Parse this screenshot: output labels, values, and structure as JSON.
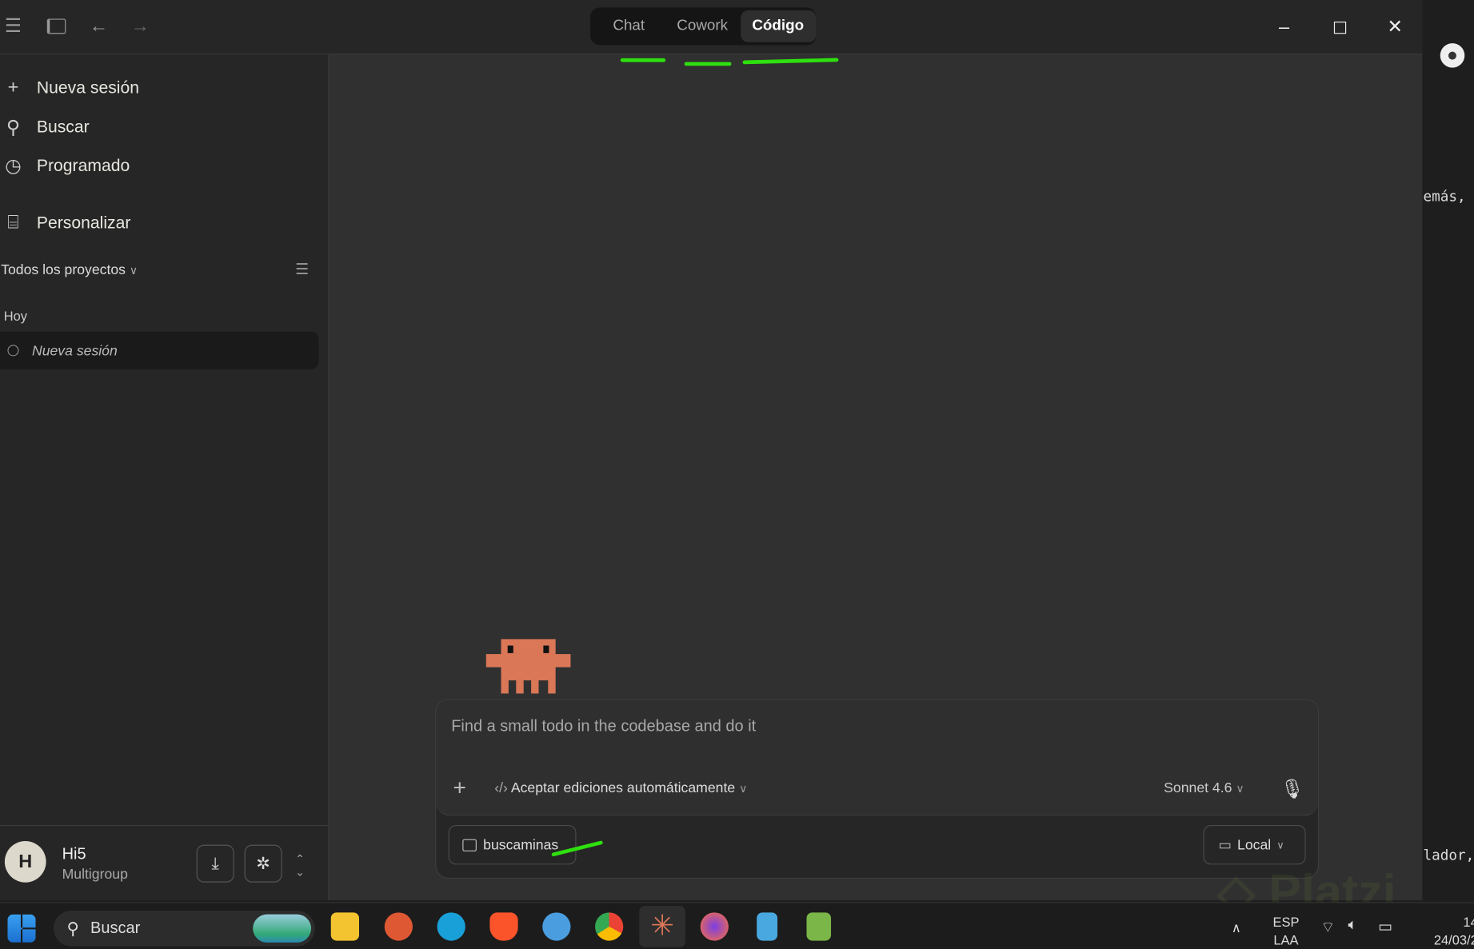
{
  "titlebar": {
    "modes": [
      "Chat",
      "Cowork",
      "Código"
    ],
    "active_mode": "Código"
  },
  "sidebar": {
    "nav": [
      {
        "label": "Nueva sesión",
        "icon": "plus-icon"
      },
      {
        "label": "Buscar",
        "icon": "search-icon"
      },
      {
        "label": "Programado",
        "icon": "clock-icon"
      },
      {
        "label": "Personalizar",
        "icon": "briefcase-icon"
      }
    ],
    "projects_filter": "Todos los proyectos",
    "group_label": "Hoy",
    "sessions": [
      {
        "title": "Nueva sesión"
      }
    ],
    "user": {
      "initial": "H",
      "name": "Hi5",
      "org": "Multigroup"
    }
  },
  "composer": {
    "placeholder": "Find a small todo in the codebase and do it",
    "mode": "Aceptar ediciones automáticamente",
    "model": "Sonnet 4.6",
    "folder": "buscaminas",
    "environment": "Local"
  },
  "background_window": {
    "lines": [
      "emás,",
      "lador,"
    ]
  },
  "taskbar": {
    "search": "Buscar",
    "lang1": "ESP",
    "lang2": "LAA",
    "time": "14",
    "date": "24/03/2"
  },
  "watermark": "Platzi"
}
